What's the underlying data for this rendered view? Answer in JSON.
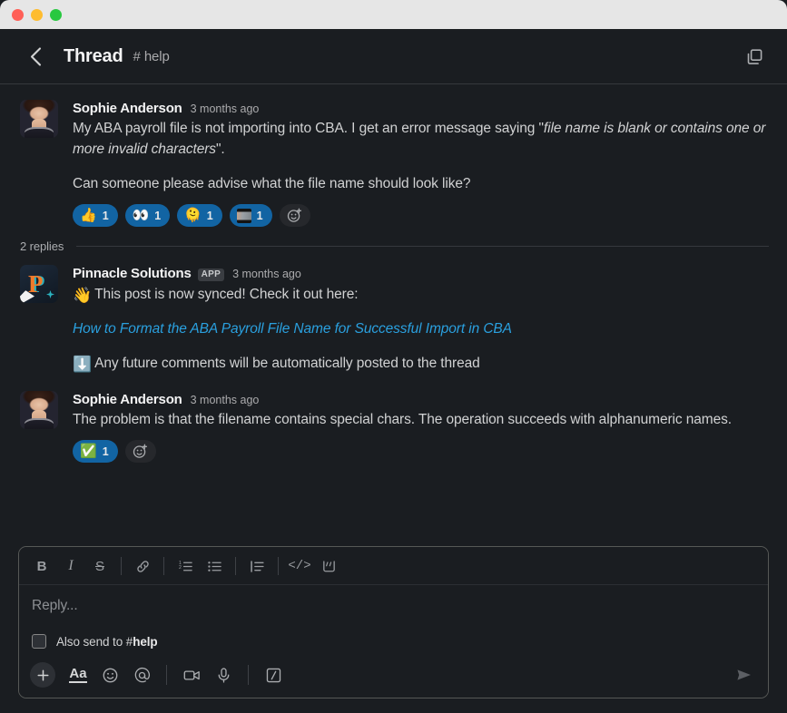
{
  "window": {
    "traffic_lights": [
      "close",
      "minimize",
      "zoom"
    ],
    "titlebar_color": "#e6e6e6"
  },
  "header": {
    "back_icon": "chevron-left-icon",
    "title": "Thread",
    "channel_hash": "#",
    "channel_name": "help",
    "open_window_icon": "open-in-new-window-icon"
  },
  "theme": {
    "background": "#1a1d21",
    "text": "#d1d2d3",
    "link": "#2aa0df",
    "reaction_active": "#1264a3",
    "divider": "#35383d"
  },
  "messages": [
    {
      "id": "root-message",
      "author": "Sophie Anderson",
      "avatar_type": "photo",
      "is_app": false,
      "timestamp": "3 months ago",
      "paragraph1_pre": "My ABA payroll file is not importing into CBA. I get an error message saying \"",
      "paragraph1_italic": "file name is blank or contains one or more invalid characters",
      "paragraph1_post": "\".",
      "paragraph2": "Can someone please advise what the file name should look like?",
      "reactions": [
        {
          "name": "thumbsup",
          "emoji": "👍",
          "count": "1",
          "active": true,
          "custom": false
        },
        {
          "name": "eyes",
          "emoji": "👀",
          "count": "1",
          "active": true,
          "custom": false
        },
        {
          "name": "melting-face",
          "emoji": "🫠",
          "count": "1",
          "active": true,
          "custom": false
        },
        {
          "name": "custom-image-emoji",
          "emoji": "",
          "count": "1",
          "active": true,
          "custom": true
        }
      ],
      "add_reaction_icon": "add-reaction-icon"
    }
  ],
  "replies_divider": {
    "count_label": "2 replies"
  },
  "replies": [
    {
      "id": "reply-bot",
      "author": "Pinnacle Solutions",
      "avatar_type": "app",
      "avatar_letter": "P",
      "is_app": true,
      "app_badge": "APP",
      "timestamp": "3 months ago",
      "line1_emoji": "👋",
      "line1_text": "This post is now synced! Check it out here:",
      "link_text": "How to Format the ABA Payroll File Name for Successful Import in CBA",
      "line2_emoji": "⬇️",
      "line2_text": "Any future comments will be automatically posted to the thread"
    },
    {
      "id": "reply-user",
      "author": "Sophie Anderson",
      "avatar_type": "photo",
      "is_app": false,
      "timestamp": "3 months ago",
      "text": "The problem is that the filename contains special chars. The operation succeeds with alphanumeric names.",
      "reactions": [
        {
          "name": "white-check-mark",
          "emoji": "✅",
          "count": "1",
          "active": true,
          "custom": false
        }
      ],
      "add_reaction_icon": "add-reaction-icon"
    }
  ],
  "composer": {
    "format_buttons": [
      {
        "name": "bold",
        "glyph": "B",
        "style": "bold"
      },
      {
        "name": "italic",
        "glyph": "I",
        "style": "italic"
      },
      {
        "name": "strikethrough",
        "glyph": "S",
        "style": "strike"
      },
      {
        "name": "link",
        "glyph": "link"
      },
      {
        "name": "ordered-list",
        "glyph": "ol"
      },
      {
        "name": "bulleted-list",
        "glyph": "ul"
      },
      {
        "name": "blockquote",
        "glyph": "quote"
      },
      {
        "name": "code",
        "glyph": "</>"
      },
      {
        "name": "code-block",
        "glyph": "codeblock"
      }
    ],
    "placeholder": "Reply...",
    "also_send_prefix": "Also send to",
    "also_send_hash": "#",
    "also_send_channel": "help",
    "also_send_checked": false,
    "actions": [
      {
        "name": "attach-plus",
        "glyph": "+"
      },
      {
        "name": "formatting",
        "glyph": "Aa"
      },
      {
        "name": "emoji",
        "glyph": "emoji"
      },
      {
        "name": "mention",
        "glyph": "@"
      },
      {
        "name": "video-clip",
        "glyph": "video"
      },
      {
        "name": "audio-clip",
        "glyph": "mic"
      },
      {
        "name": "slash-command",
        "glyph": "slash"
      }
    ],
    "send_icon": "send-icon",
    "send_enabled": false
  }
}
